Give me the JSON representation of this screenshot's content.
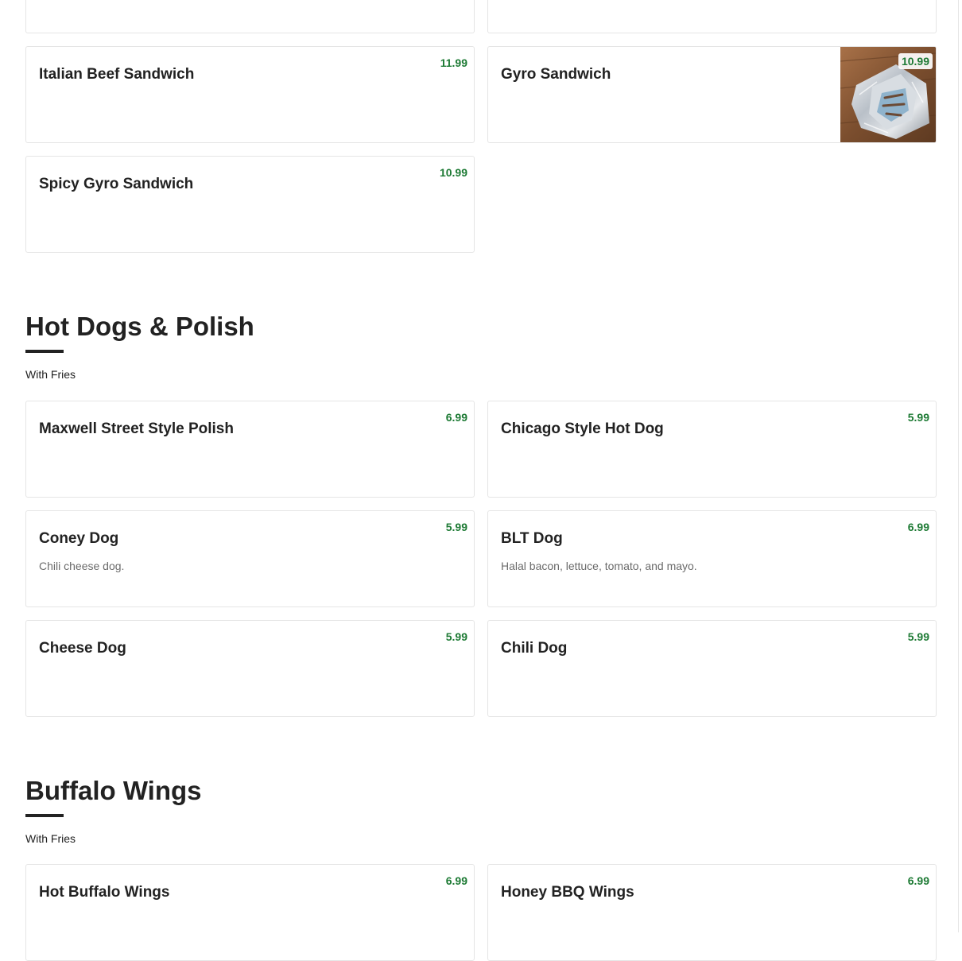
{
  "sections": [
    {
      "items": [
        {
          "name": "",
          "price": ""
        },
        {
          "name": "",
          "price": ""
        },
        {
          "name": "Italian Beef Sandwich",
          "price": "11.99",
          "description": ""
        },
        {
          "name": "Gyro Sandwich",
          "price": "10.99",
          "description": "",
          "has_photo": true
        },
        {
          "name": "Spicy Gyro Sandwich",
          "price": "10.99",
          "description": ""
        }
      ]
    },
    {
      "title": "Hot Dogs & Polish",
      "subtitle": "With Fries",
      "items": [
        {
          "name": "Maxwell Street Style Polish",
          "price": "6.99",
          "description": ""
        },
        {
          "name": "Chicago Style Hot Dog",
          "price": "5.99",
          "description": ""
        },
        {
          "name": "Coney Dog",
          "price": "5.99",
          "description": "Chili cheese dog."
        },
        {
          "name": "BLT Dog",
          "price": "6.99",
          "description": "Halal bacon, lettuce, tomato, and mayo."
        },
        {
          "name": "Cheese Dog",
          "price": "5.99",
          "description": ""
        },
        {
          "name": "Chili Dog",
          "price": "5.99",
          "description": ""
        }
      ]
    },
    {
      "title": "Buffalo Wings",
      "subtitle": "With Fries",
      "items": [
        {
          "name": "Hot Buffalo Wings",
          "price": "6.99",
          "description": ""
        },
        {
          "name": "Honey BBQ Wings",
          "price": "6.99",
          "description": ""
        }
      ]
    }
  ],
  "colors": {
    "price": "#1d7a34",
    "text": "#222222",
    "muted": "#6b6b6b",
    "border": "#e5e5e5"
  },
  "icons": {
    "gyro_photo": "food-photo-foil-wrapped-gyro"
  }
}
